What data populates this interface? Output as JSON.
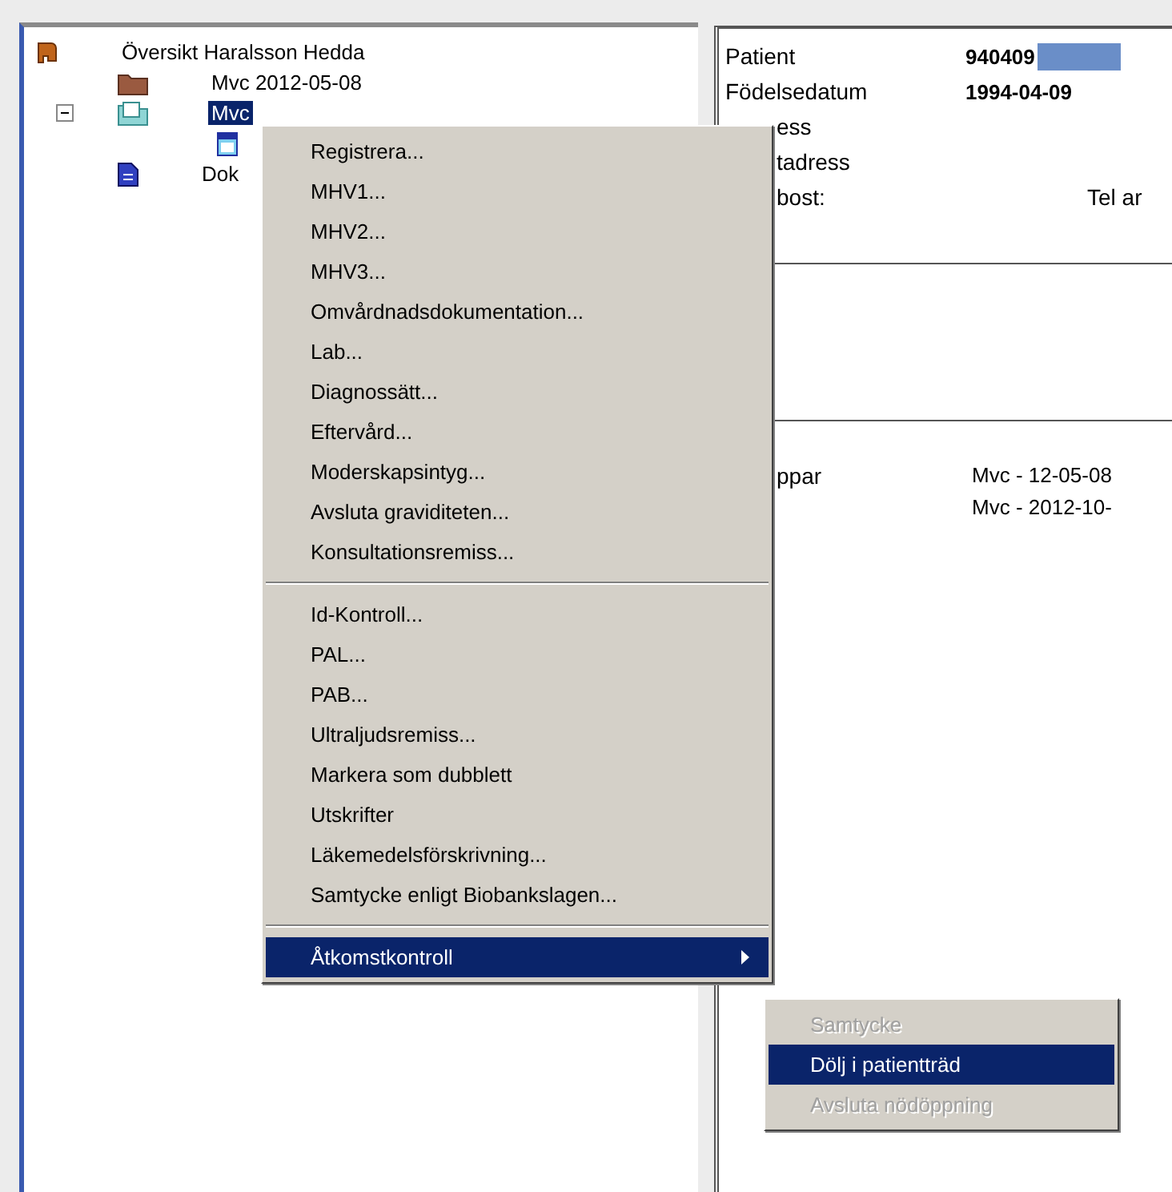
{
  "tree": {
    "label": "Översikt Haralsson Hedda",
    "kind": "root",
    "children": [
      {
        "label": "Mvc 2012-05-08",
        "kind": "folder",
        "selected": false
      },
      {
        "label": "Mvc",
        "kind": "record",
        "selected": true,
        "expanded": true,
        "children": [
          {
            "kind": "calendar"
          }
        ]
      },
      {
        "label": "Dok",
        "kind": "document",
        "selected": false
      }
    ]
  },
  "patient_panel": {
    "rows": [
      {
        "label": "Patient",
        "value": "940409",
        "redacted": true
      },
      {
        "label": "Födelsedatum",
        "value": "1994-04-09"
      },
      {
        "label": "ess"
      },
      {
        "label": "tadress"
      },
      {
        "label": "bost:",
        "extra": "Tel ar"
      }
    ],
    "history": {
      "label": "ppar",
      "values": [
        "Mvc - 12-05-08",
        "Mvc - 2012-10-"
      ]
    }
  },
  "context_menu": {
    "sections": [
      [
        {
          "label": "Registrera...",
          "selected": false
        },
        {
          "label": "MHV1...",
          "selected": false
        },
        {
          "label": "MHV2...",
          "selected": false
        },
        {
          "label": "MHV3...",
          "selected": false
        },
        {
          "label": "Omvårdnadsdokumentation...",
          "selected": false
        },
        {
          "label": "Lab...",
          "selected": false
        },
        {
          "label": "Diagnossätt...",
          "selected": false
        },
        {
          "label": "Eftervård...",
          "selected": false
        },
        {
          "label": "Moderskapsintyg...",
          "selected": false
        },
        {
          "label": "Avsluta graviditeten...",
          "selected": false
        },
        {
          "label": "Konsultationsremiss...",
          "selected": false
        }
      ],
      [
        {
          "label": "Id-Kontroll...",
          "selected": false
        },
        {
          "label": "PAL...",
          "selected": false
        },
        {
          "label": "PAB...",
          "selected": false
        },
        {
          "label": "Ultraljudsremiss...",
          "selected": false
        },
        {
          "label": "Markera som dubblett",
          "selected": false
        },
        {
          "label": "Utskrifter",
          "selected": false
        },
        {
          "label": "Läkemedelsförskrivning...",
          "selected": false
        },
        {
          "label": "Samtycke enligt Biobankslagen...",
          "selected": false
        }
      ],
      [
        {
          "label": "Åtkomstkontroll",
          "selected": true,
          "submenu": true
        }
      ]
    ]
  },
  "submenu": [
    {
      "label": "Samtycke",
      "selected": false,
      "disabled": true
    },
    {
      "label": "Dölj i patientträd",
      "selected": true,
      "disabled": false
    },
    {
      "label": "Avsluta nödöppning",
      "selected": false,
      "disabled": true
    }
  ]
}
